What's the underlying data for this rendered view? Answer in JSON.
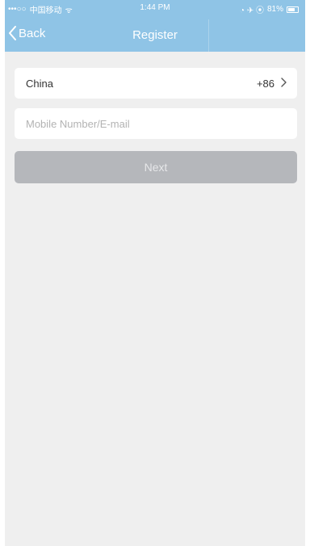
{
  "status_bar": {
    "signal": "•••○○",
    "carrier": "中国移动",
    "wifi": "ᯤ",
    "time": "1:44 PM",
    "indicators": "◔ ✈ ⦿",
    "battery_percent": "81%"
  },
  "nav": {
    "back_label": "Back",
    "title": "Register"
  },
  "form": {
    "country_name": "China",
    "country_code": "+86",
    "account_placeholder": "Mobile Number/E-mail",
    "account_value": "",
    "next_label": "Next",
    "next_enabled": false
  },
  "colors": {
    "header_bg": "#8fc4e6",
    "page_bg": "#efefef",
    "button_disabled_bg": "#b5b7bb"
  },
  "icons": {
    "back": "chevron-left-icon",
    "country_arrow": "chevron-right-icon",
    "wifi": "wifi-icon",
    "battery": "battery-icon"
  }
}
